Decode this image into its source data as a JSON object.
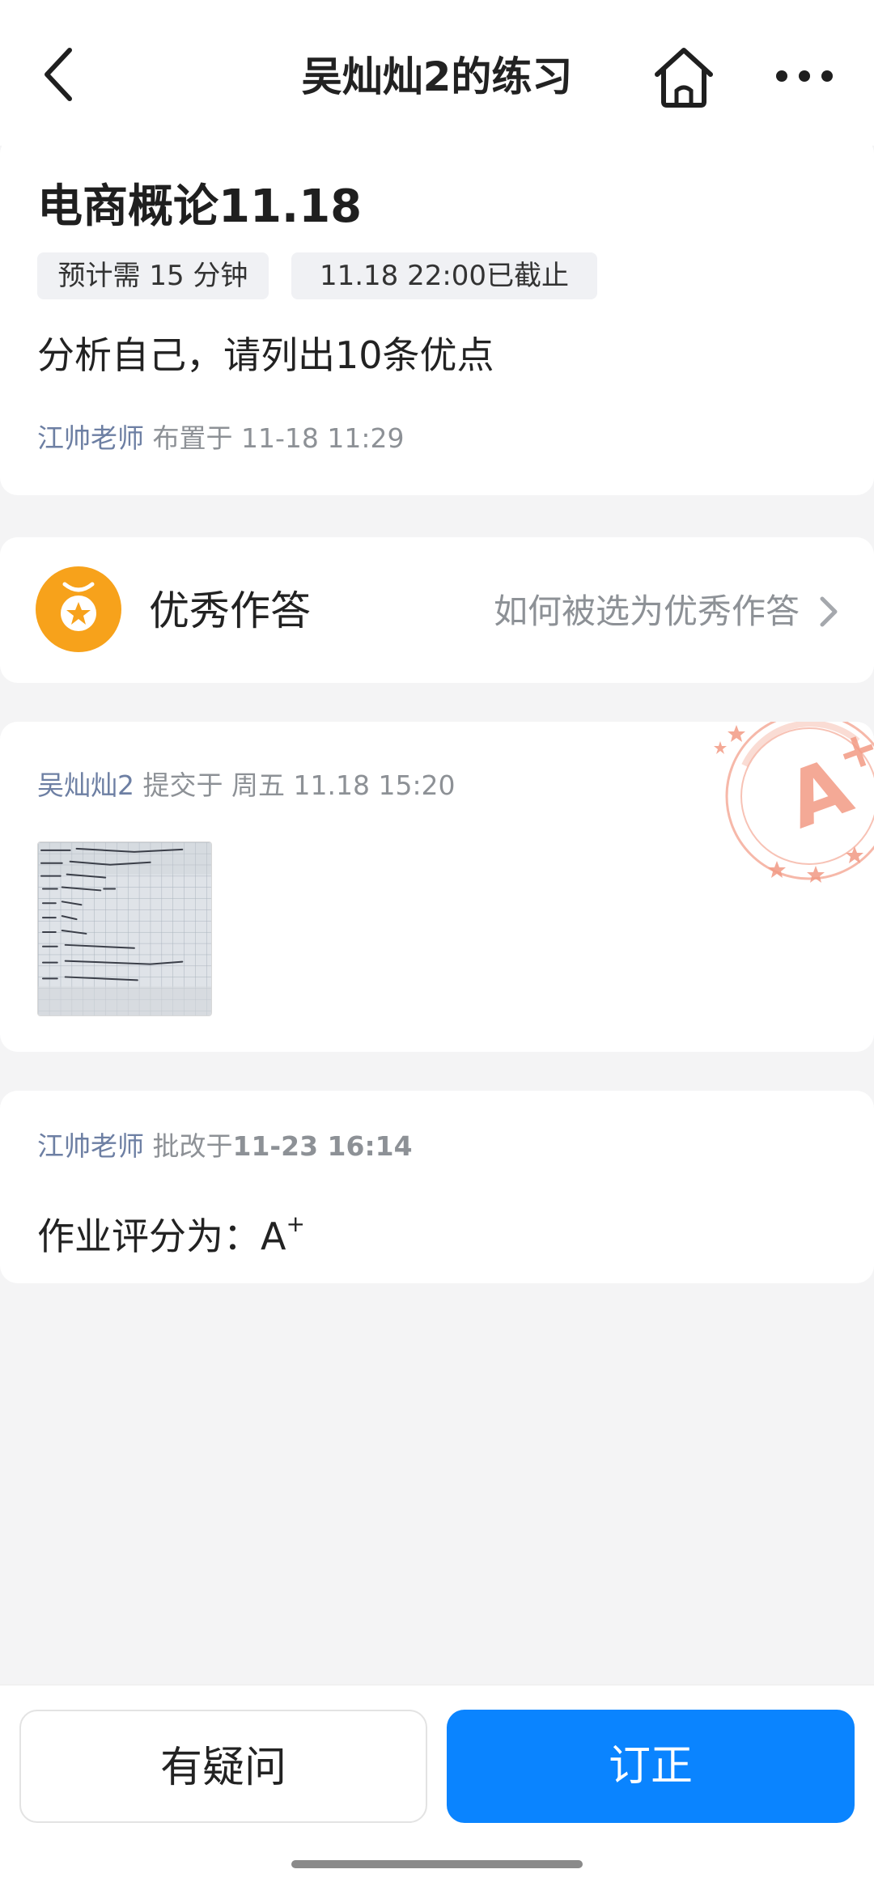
{
  "nav": {
    "title": "吴灿灿2的练习",
    "back_icon": "chevron-left-icon",
    "home_icon": "home-icon",
    "more_icon": "more-dots-icon"
  },
  "assignment": {
    "title": "电商概论11.18",
    "estimate_tag": "预计需 15 分钟",
    "deadline_tag": "11.18 22:00已截止",
    "question": "分析自己，请列出10条优点",
    "teacher": "江帅老师",
    "assigned_text": "布置于 11-18 11:29"
  },
  "excellent": {
    "icon": "medal-icon",
    "label": "优秀作答",
    "link": "如何被选为优秀作答"
  },
  "submission": {
    "student": "吴灿灿2",
    "submitted_text": "提交于",
    "submitted_time": "周五 11.18 15:20",
    "stamp_icon": "grade-stamp-icon",
    "stamp_text": "A+"
  },
  "grading": {
    "teacher": "江帅老师",
    "graded_label": "批改于",
    "graded_time": "11-23 16:14",
    "result_label": "作业评分为：",
    "grade": "A",
    "grade_sup": "+"
  },
  "actions": {
    "question_button": "有疑问",
    "correct_button": "订正"
  },
  "colors": {
    "primary": "#0a84ff",
    "medal": "#f7a21b",
    "stamp": "#f29a84",
    "meta_name": "#6d7fa3"
  }
}
